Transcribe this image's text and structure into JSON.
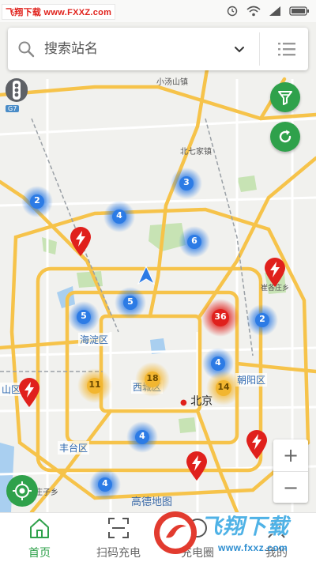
{
  "watermark": {
    "text": "飞翔下载 www.FXXZ.com"
  },
  "search": {
    "placeholder": "搜索站名"
  },
  "traffic": {
    "tag": "G7"
  },
  "map": {
    "places": [
      {
        "name": "小汤山镇"
      },
      {
        "name": "北七家镇"
      },
      {
        "name": "崔各庄乡"
      },
      {
        "name": "海淀区"
      },
      {
        "name": "西城区"
      },
      {
        "name": "北京"
      },
      {
        "name": "朝阳区"
      },
      {
        "name": "丰台区"
      },
      {
        "name": "山区"
      },
      {
        "name": "花庄子乡"
      },
      {
        "name": "高德地图"
      }
    ],
    "clusters": [
      {
        "count": "2",
        "color": "blue"
      },
      {
        "count": "3",
        "color": "blue"
      },
      {
        "count": "4",
        "color": "blue"
      },
      {
        "count": "6",
        "color": "blue"
      },
      {
        "count": "5",
        "color": "blue"
      },
      {
        "count": "5",
        "color": "blue"
      },
      {
        "count": "2",
        "color": "blue"
      },
      {
        "count": "4",
        "color": "blue"
      },
      {
        "count": "4",
        "color": "blue"
      },
      {
        "count": "4",
        "color": "blue"
      },
      {
        "count": "18",
        "color": "yellow"
      },
      {
        "count": "11",
        "color": "yellow"
      },
      {
        "count": "14",
        "color": "yellow"
      },
      {
        "count": "36",
        "color": "red"
      }
    ],
    "colors": {
      "water": "#a9cff0",
      "park": "#c7e3b4",
      "highway": "#f6c34a",
      "road": "#ffffff",
      "blue": "#2c7be5",
      "yellow": "#f2b630",
      "red": "#e0201c",
      "green": "#2fa14b"
    }
  },
  "zoom": {
    "plus": "+",
    "minus": "−"
  },
  "tabs": [
    {
      "label": "首页",
      "icon": "home-icon",
      "active": true
    },
    {
      "label": "扫码充电",
      "icon": "scan-icon",
      "active": false
    },
    {
      "label": "充电圈",
      "icon": "community-icon",
      "active": false
    },
    {
      "label": "我的",
      "icon": "profile-icon",
      "active": false
    }
  ],
  "brand": {
    "text": "飞翔下载",
    "url": "www.fxxz.com"
  }
}
